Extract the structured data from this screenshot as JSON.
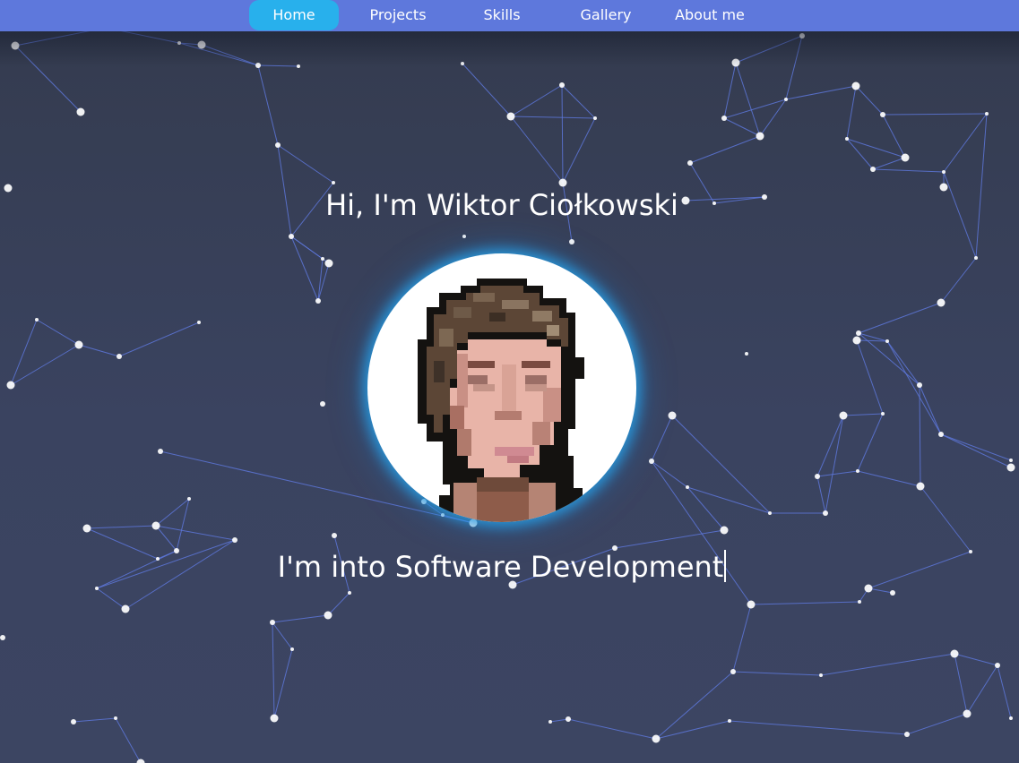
{
  "nav": {
    "items": [
      {
        "label": "Home",
        "active": true
      },
      {
        "label": "Projects",
        "active": false
      },
      {
        "label": "Skills",
        "active": false
      },
      {
        "label": "Gallery",
        "active": false
      },
      {
        "label": "About me",
        "active": false
      }
    ]
  },
  "hero": {
    "title": "Hi, I'm Wiktor Ciołkowski",
    "typed_text": "I'm into Software Development"
  },
  "colors": {
    "nav_bar": "#5e78dc",
    "nav_active": "#28b0ec",
    "background": "#3a4360",
    "network_lines": "#5f79e0",
    "avatar_glow": "#28a0e6"
  },
  "icons": {
    "avatar": "pixel-art-portrait-icon",
    "background": "particle-network-background"
  }
}
